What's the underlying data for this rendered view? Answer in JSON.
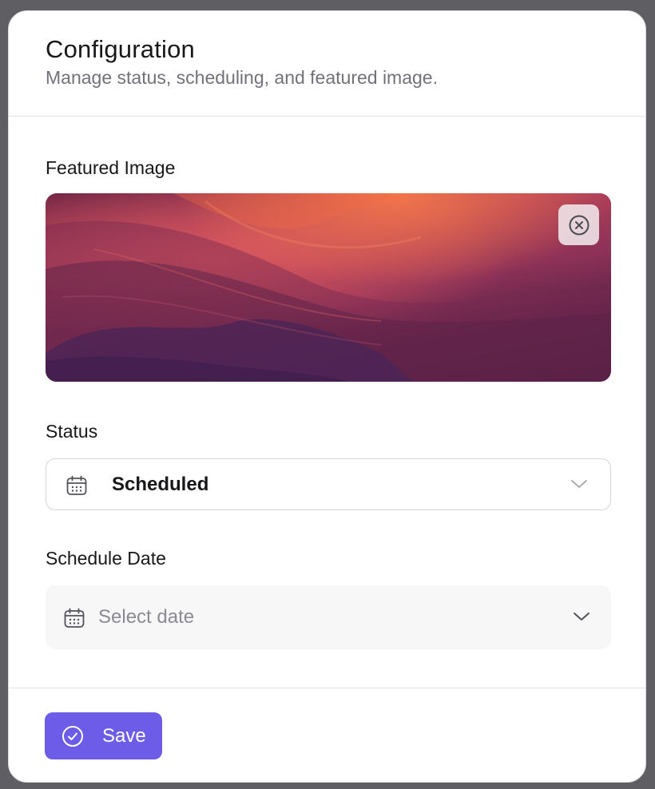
{
  "header": {
    "title": "Configuration",
    "subtitle": "Manage status, scheduling, and featured image."
  },
  "featured_image": {
    "label": "Featured Image",
    "remove_icon": "close-circle-icon"
  },
  "status": {
    "label": "Status",
    "value": "Scheduled",
    "icon": "calendar-icon"
  },
  "schedule_date": {
    "label": "Schedule Date",
    "placeholder": "Select date",
    "icon": "calendar-icon"
  },
  "footer": {
    "save_label": "Save",
    "save_icon": "check-circle-icon",
    "accent": "#6c5ce7"
  }
}
